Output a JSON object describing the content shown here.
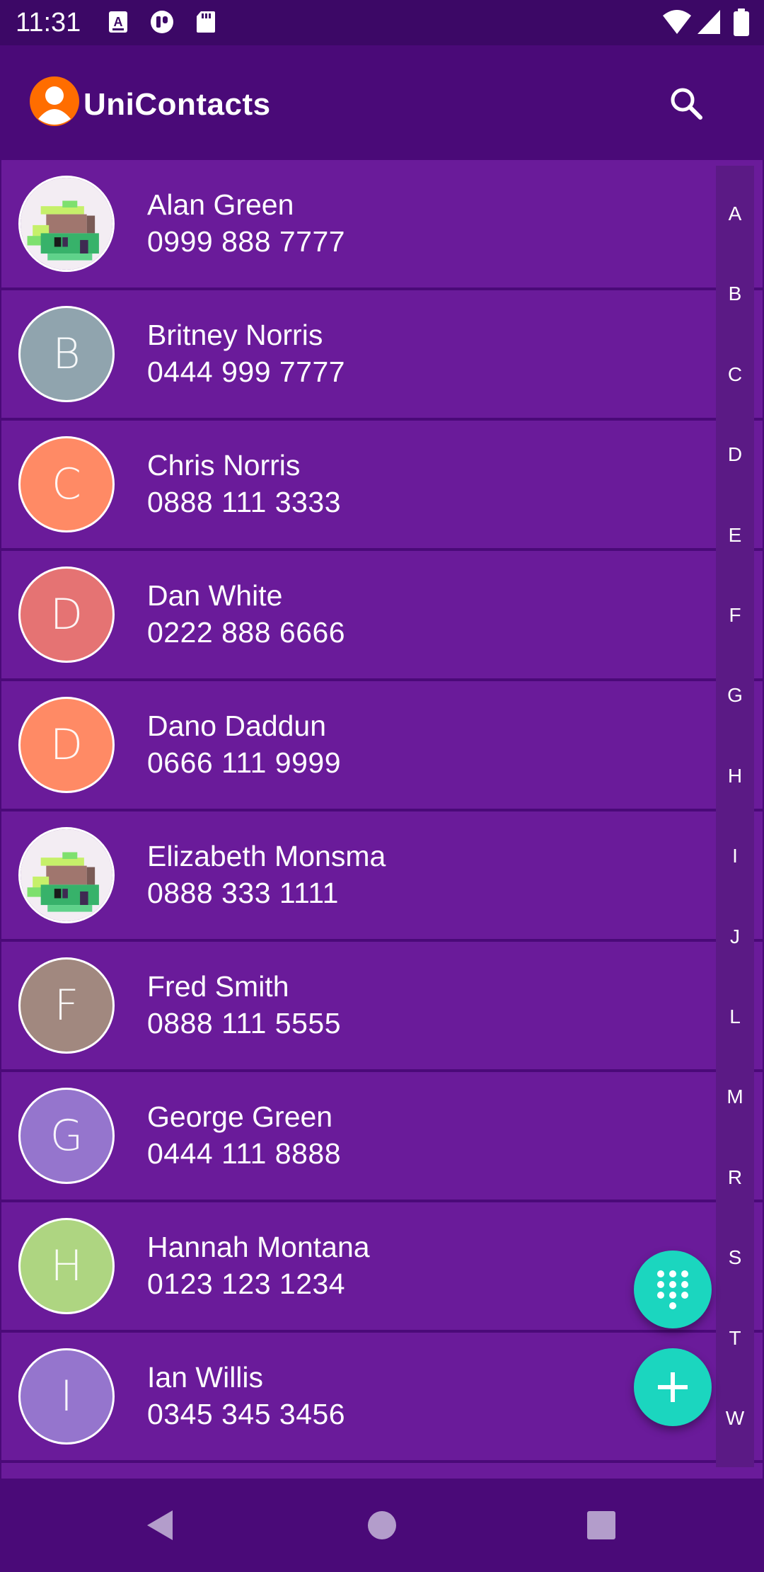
{
  "status_bar": {
    "time": "11:31",
    "left_icons": [
      "text-notification-icon",
      "app-notification-icon",
      "sd-card-icon"
    ],
    "right_icons": [
      "wifi-icon",
      "signal-icon",
      "battery-icon"
    ]
  },
  "app_bar": {
    "title": "UniContacts",
    "logo_icon": "person-avatar-icon",
    "search_icon": "search-icon"
  },
  "colors": {
    "app_bar": "#4a0a78",
    "list_row": "#6a1b9a",
    "index_bar": "#5b1a85",
    "fab": "#1bd6bf"
  },
  "contacts": [
    {
      "name": "Alan Green",
      "phone": "0999 888 7777",
      "avatar": "image",
      "initial": ""
    },
    {
      "name": "Britney Norris",
      "phone": "0444 999 7777",
      "avatar": "letter",
      "initial": "B",
      "color": "#90a4ae"
    },
    {
      "name": "Chris Norris",
      "phone": "0888 111 3333",
      "avatar": "letter",
      "initial": "C",
      "color": "#ff8a65"
    },
    {
      "name": "Dan White",
      "phone": "0222 888 6666",
      "avatar": "letter",
      "initial": "D",
      "color": "#e57373"
    },
    {
      "name": "Dano Daddun",
      "phone": "0666 111 9999",
      "avatar": "letter",
      "initial": "D",
      "color": "#ff8a65"
    },
    {
      "name": "Elizabeth Monsma",
      "phone": "0888 333 1111",
      "avatar": "image",
      "initial": ""
    },
    {
      "name": "Fred Smith",
      "phone": "0888 111 5555",
      "avatar": "letter",
      "initial": "F",
      "color": "#a1887f"
    },
    {
      "name": "George Green",
      "phone": "0444 111 8888",
      "avatar": "letter",
      "initial": "G",
      "color": "#9575cd"
    },
    {
      "name": "Hannah Montana",
      "phone": "0123 123 1234",
      "avatar": "letter",
      "initial": "H",
      "color": "#aed581"
    },
    {
      "name": "Ian Willis",
      "phone": "0345 345 3456",
      "avatar": "letter",
      "initial": "I",
      "color": "#9575cd"
    }
  ],
  "index_letters": [
    "A",
    "B",
    "C",
    "D",
    "E",
    "F",
    "G",
    "H",
    "I",
    "J",
    "L",
    "M",
    "R",
    "S",
    "T",
    "W"
  ],
  "fabs": {
    "dialpad_icon": "dialpad-icon",
    "add_icon": "add-icon"
  },
  "nav_bar": {
    "back_icon": "back-icon",
    "home_icon": "home-icon",
    "recents_icon": "recents-icon"
  }
}
